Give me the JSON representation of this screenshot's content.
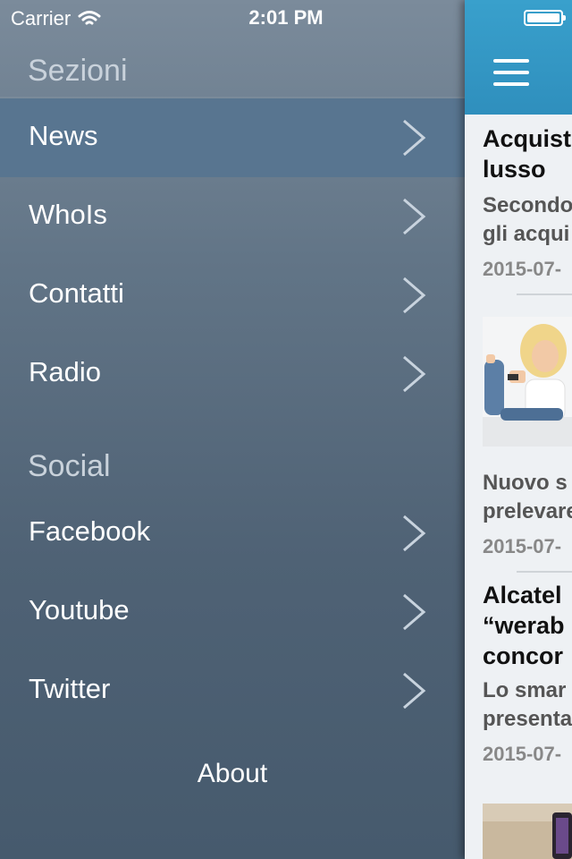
{
  "status_bar": {
    "carrier": "Carrier",
    "time": "2:01 PM"
  },
  "drawer": {
    "sections_header": "Sezioni",
    "sections": [
      {
        "label": "News",
        "active": true
      },
      {
        "label": "WhoIs"
      },
      {
        "label": "Contatti"
      },
      {
        "label": "Radio"
      }
    ],
    "social_header": "Social",
    "social": [
      {
        "label": "Facebook"
      },
      {
        "label": "Youtube"
      },
      {
        "label": "Twitter"
      }
    ],
    "about": "About"
  },
  "feed": {
    "articles": [
      {
        "title_lines": [
          "Acquist",
          "lusso"
        ],
        "excerpt_lines": [
          "Secondo",
          "gli acqui"
        ],
        "date": "2015-07-"
      },
      {
        "image": "woman-with-smartphone-photo",
        "excerpt_lines": [
          "Nuovo s",
          "prelevare"
        ],
        "date": "2015-07-"
      },
      {
        "title_lines": [
          "Alcatel",
          "“werab",
          "concor"
        ],
        "excerpt_lines": [
          "Lo smar",
          "presenta"
        ],
        "date": "2015-07-"
      }
    ]
  },
  "colors": {
    "accent": "#39a0cc",
    "drawer_active": "#587590"
  }
}
